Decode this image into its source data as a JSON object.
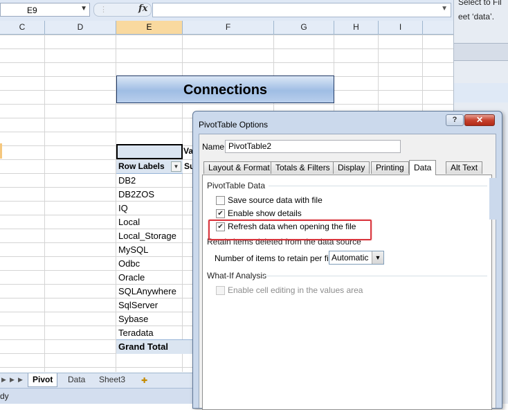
{
  "excel": {
    "name_box": "E9",
    "fx_label": "fx",
    "columns": [
      {
        "label": "C",
        "selected": false
      },
      {
        "label": "D",
        "selected": false
      },
      {
        "label": "E",
        "selected": true
      },
      {
        "label": "F",
        "selected": false
      },
      {
        "label": "G",
        "selected": false
      },
      {
        "label": "H",
        "selected": false
      },
      {
        "label": "I",
        "selected": false
      }
    ],
    "title_banner": "Connections",
    "values_partial": "Va",
    "row_labels_header": "Row Labels",
    "sum_partial": "Su",
    "pivot_rows": [
      "DB2",
      "DB2ZOS",
      "IQ",
      "Local",
      "Local_Storage",
      "MySQL",
      "Odbc",
      "Oracle",
      "SQLAnywhere",
      "SqlServer",
      "Sybase",
      "Teradata"
    ],
    "grand_total": "Grand Total",
    "sheet_tabs": [
      "Pivot",
      "Data",
      "Sheet3"
    ],
    "active_sheet": "Pivot",
    "status_text": "dy"
  },
  "side_panel": {
    "line1": "Select to Fil",
    "line2": "eet ‘data’."
  },
  "dialog": {
    "title": "PivotTable Options",
    "help_label": "?",
    "close_label": "✕",
    "name_label": "Name:",
    "name_value": "PivotTable2",
    "tabs": [
      "Layout & Format",
      "Totals & Filters",
      "Display",
      "Printing",
      "Data",
      "Alt Text"
    ],
    "active_tab": "Data",
    "section_pivot_data": "PivotTable Data",
    "save_source_label": "Save source data with file",
    "save_source_checked": false,
    "enable_show_details_label": "Enable show details",
    "enable_show_details_checked": true,
    "refresh_label": "Refresh data when opening the file",
    "refresh_checked": true,
    "section_retain": "Retain items deleted from the data source",
    "retain_label": "Number of items to retain per field:",
    "retain_value": "Automatic",
    "section_whatif": "What-If Analysis",
    "cell_editing_label": "Enable cell editing in the values area",
    "cell_editing_checked": false,
    "highlight_color": "#d9363e"
  }
}
